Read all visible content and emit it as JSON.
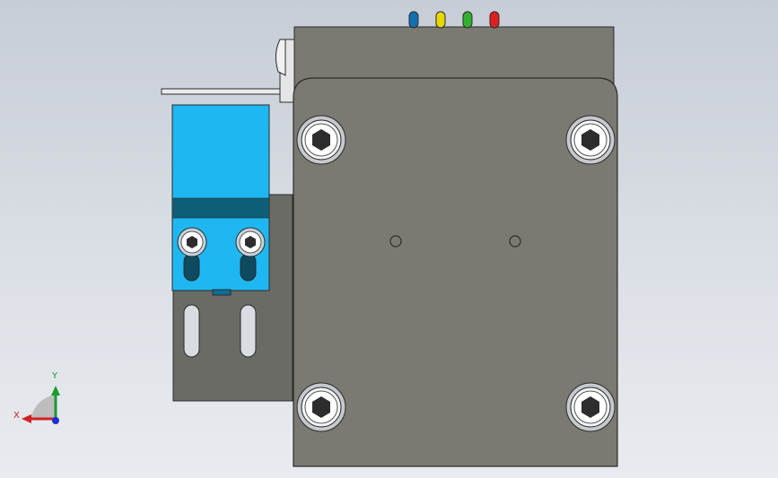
{
  "viewport": {
    "background": [
      "#c7cdd6",
      "#e8ebef"
    ]
  },
  "triad": {
    "x_label": "X",
    "y_label": "Y",
    "x_color": "#d32020",
    "y_color": "#1d9a2c",
    "z_color": "#1b2fd0"
  },
  "colors": {
    "body_gray": "#7a7a72",
    "body_edge": "#2b2b2b",
    "bracket": "#6b6b66",
    "sensor_blue": "#1eb7f2",
    "sensor_band": "#0f5e78",
    "wire_colors": [
      "#1070b0",
      "#e8d800",
      "#33b02f",
      "#e02020"
    ]
  }
}
